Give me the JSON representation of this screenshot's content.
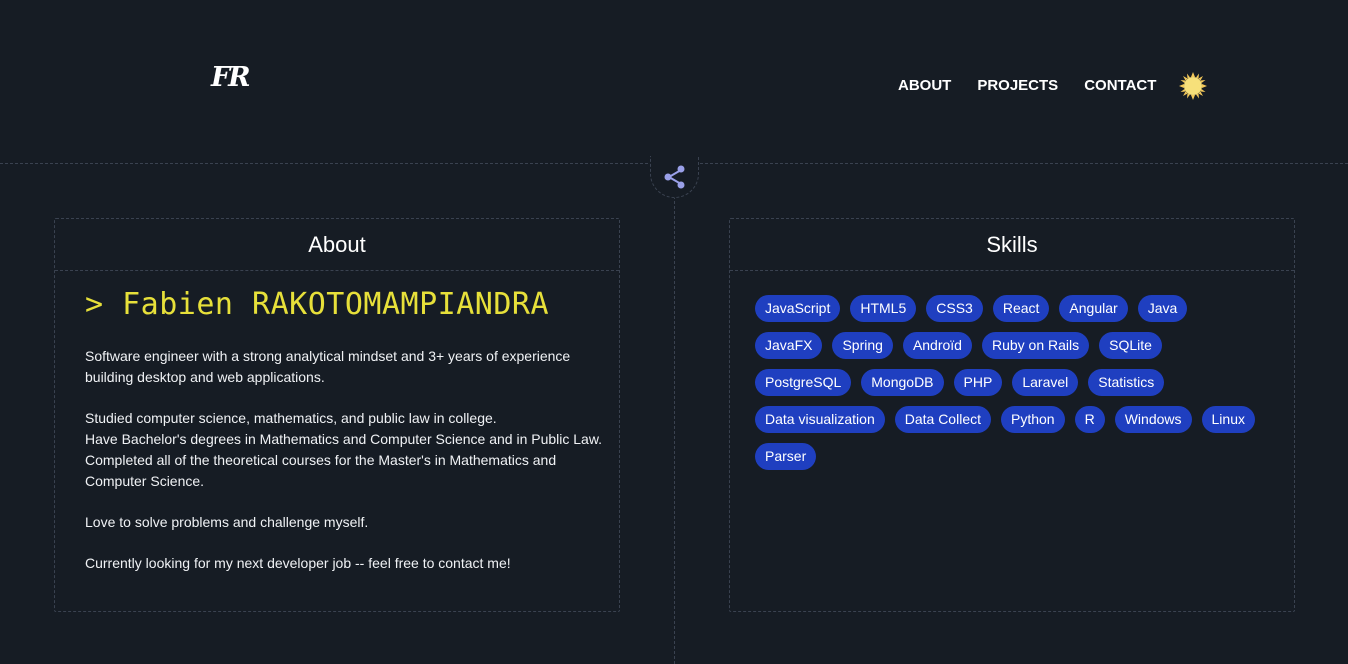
{
  "header": {
    "logo": "FR",
    "nav": [
      {
        "label": "ABOUT"
      },
      {
        "label": "PROJECTS"
      },
      {
        "label": "CONTACT"
      }
    ],
    "theme_icon": "sun-icon",
    "theme_color": "#f7e07a"
  },
  "share_icon": "share-icon",
  "about": {
    "title": "About",
    "name": "> Fabien RAKOTOMAMPIANDRA",
    "paragraphs": [
      [
        "Software engineer with a strong analytical mindset and 3+ years of experience",
        "building desktop and web applications."
      ],
      [
        "Studied computer science, mathematics, and public law in college.",
        "Have Bachelor's degrees in Mathematics and Computer Science and in Public Law.",
        "Completed all of the theoretical courses for the Master's in Mathematics and",
        "Computer Science."
      ],
      [
        "Love to solve problems and challenge myself."
      ],
      [
        "Currently looking for my next developer job -- feel free to contact me!"
      ]
    ]
  },
  "skills": {
    "title": "Skills",
    "items": [
      "JavaScript",
      "HTML5",
      "CSS3",
      "React",
      "Angular",
      "Java",
      "JavaFX",
      "Spring",
      "Androïd",
      "Ruby on Rails",
      "SQLite",
      "PostgreSQL",
      "MongoDB",
      "PHP",
      "Laravel",
      "Statistics",
      "Data visualization",
      "Data Collect",
      "Python",
      "R",
      "Windows",
      "Linux",
      "Parser"
    ],
    "badge_color": "#1f3fc0"
  }
}
